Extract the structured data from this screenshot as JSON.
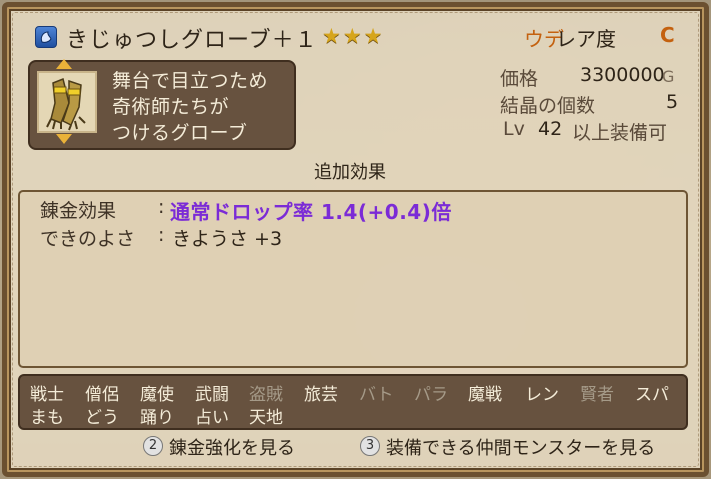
{
  "item": {
    "name": "きじゅつしグローブ＋１",
    "stars": "★★★",
    "category": "ウデ",
    "rarity_label": "レア度",
    "rarity_value": "C",
    "icon": "gauntlet-icon",
    "description": [
      "舞台で目立つため",
      "奇術師たちが",
      "つけるグローブ"
    ]
  },
  "stats": {
    "price_label": "価格",
    "price_value": "3300000",
    "price_unit": "G",
    "crystals_label": "結晶の個数",
    "crystals_value": "5",
    "level_label": "Lv",
    "level_value": "42",
    "level_suffix": "以上装備可"
  },
  "effects": {
    "header": "追加効果",
    "alchemy_label": "錬金効果",
    "alchemy_value": "通常ドロップ率 1.4(+0.4)倍",
    "quality_label": "できのよさ",
    "quality_value": "きようさ +3",
    "colon": ":"
  },
  "jobs": {
    "row1": [
      {
        "name": "戦士",
        "enabled": true
      },
      {
        "name": "僧侶",
        "enabled": true
      },
      {
        "name": "魔使",
        "enabled": true
      },
      {
        "name": "武闘",
        "enabled": true
      },
      {
        "name": "盗賊",
        "enabled": false
      },
      {
        "name": "旅芸",
        "enabled": true
      },
      {
        "name": "バト",
        "enabled": false
      },
      {
        "name": "パラ",
        "enabled": false
      },
      {
        "name": "魔戦",
        "enabled": true
      },
      {
        "name": "レン",
        "enabled": true
      },
      {
        "name": "賢者",
        "enabled": false
      },
      {
        "name": "スパ",
        "enabled": true
      }
    ],
    "row2": [
      {
        "name": "まも",
        "enabled": true
      },
      {
        "name": "どう",
        "enabled": true
      },
      {
        "name": "踊り",
        "enabled": true
      },
      {
        "name": "占い",
        "enabled": true
      },
      {
        "name": "天地",
        "enabled": true
      }
    ]
  },
  "hints": {
    "alchemy_button": "2",
    "alchemy_text": "錬金強化を見る",
    "monsters_button": "3",
    "monsters_text": "装備できる仲間モンスターを見る"
  },
  "colors": {
    "accent_orange": "#c4610f",
    "effect_purple": "#7b2bd6",
    "star_gold": "#d6a51b"
  }
}
